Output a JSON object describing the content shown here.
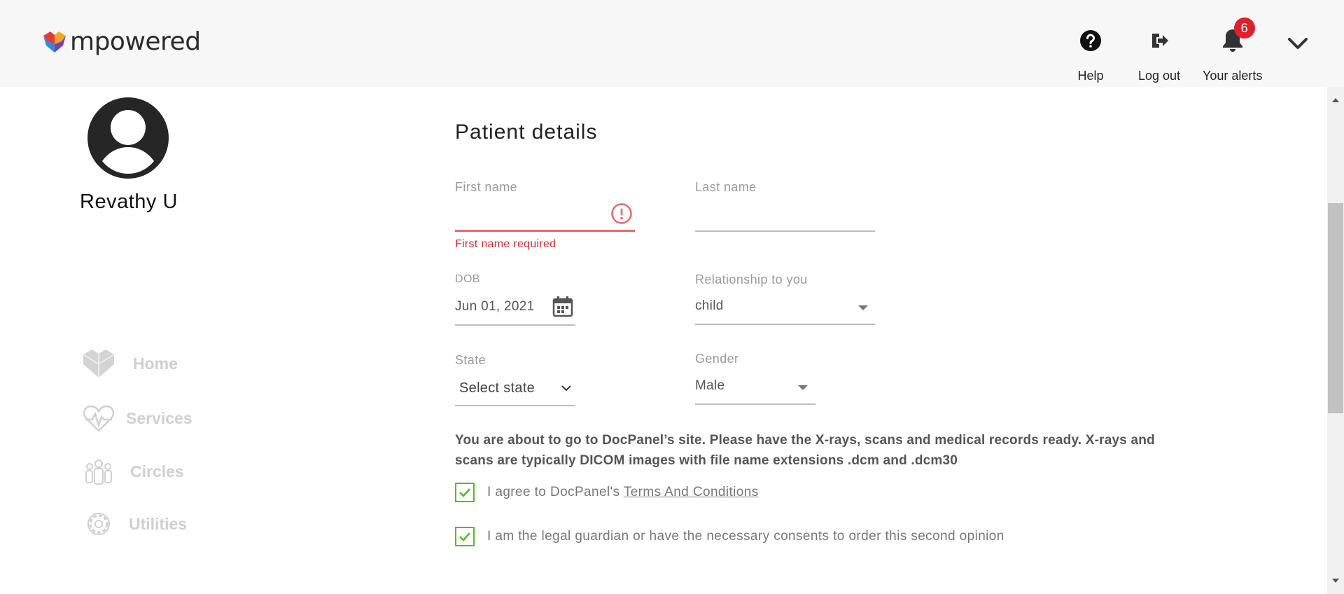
{
  "header": {
    "logo_text": "mpowered",
    "help_label": "Help",
    "logout_label": "Log out",
    "alerts_label": "Your alerts",
    "alerts_count": "6"
  },
  "profile": {
    "name": "Revathy U"
  },
  "nav": {
    "items": [
      {
        "label": "Home",
        "icon": "home-heart-icon"
      },
      {
        "label": "Services",
        "icon": "heart-pulse-icon"
      },
      {
        "label": "Circles",
        "icon": "people-group-icon"
      },
      {
        "label": "Utilities",
        "icon": "gear-icon"
      }
    ]
  },
  "form": {
    "title": "Patient details",
    "first_name": {
      "label": "First name",
      "value": "",
      "error": "First name required"
    },
    "last_name": {
      "label": "Last name",
      "value": ""
    },
    "dob": {
      "label": "DOB",
      "value": "Jun 01, 2021"
    },
    "relationship": {
      "label": "Relationship to you",
      "value": "child"
    },
    "state": {
      "label": "State",
      "value": "Select state"
    },
    "gender": {
      "label": "Gender",
      "value": "Male"
    },
    "info": "You are about to go to DocPanel’s site. Please have the X-rays, scans and medical records ready. X-rays and scans are typically DICOM images with file name extensions .dcm and .dcm30",
    "agree_prefix": "I agree to DocPanel's ",
    "agree_link": "Terms And Conditions",
    "guardian_text": "I am the legal guardian or have the necessary consents to order this second opinion",
    "agree_checked": true,
    "guardian_checked": true
  },
  "colors": {
    "accent_green": "#4fc117",
    "error_red": "#d32f2f",
    "badge_red": "#e0202a"
  }
}
